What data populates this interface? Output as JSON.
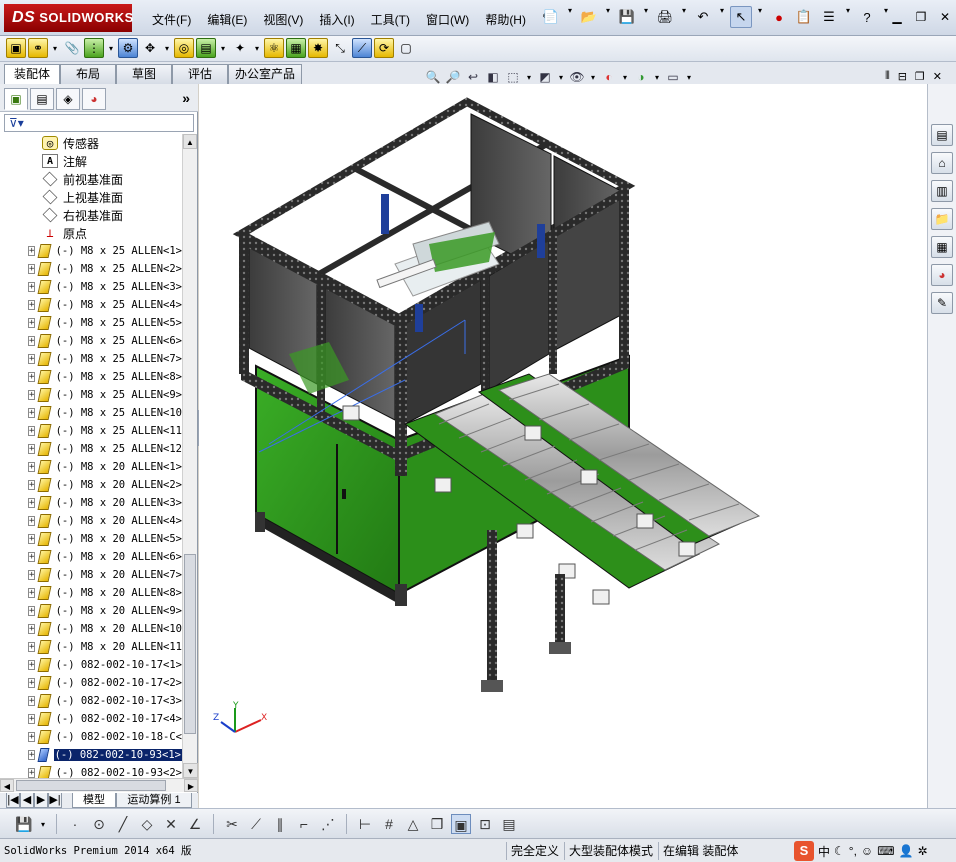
{
  "app": {
    "logo_ds": "DS",
    "logo_text": "SOLIDWORKS"
  },
  "menus": [
    "文件(F)",
    "编辑(E)",
    "视图(V)",
    "插入(I)",
    "工具(T)",
    "窗口(W)",
    "帮助(H)"
  ],
  "command_tabs": [
    "装配体",
    "布局",
    "草图",
    "评估",
    "办公室产品"
  ],
  "feature_tree": {
    "items": [
      {
        "label": "传感器",
        "icon": "sensor-icon",
        "expandable": false,
        "cn": true
      },
      {
        "label": "注解",
        "icon": "annotation-icon",
        "expandable": false,
        "cn": true
      },
      {
        "label": "前视基准面",
        "icon": "plane-icon",
        "expandable": false,
        "cn": true
      },
      {
        "label": "上视基准面",
        "icon": "plane-icon",
        "expandable": false,
        "cn": true
      },
      {
        "label": "右视基准面",
        "icon": "plane-icon",
        "expandable": false,
        "cn": true
      },
      {
        "label": "原点",
        "icon": "origin-icon",
        "expandable": false,
        "cn": true
      },
      {
        "label": "(-) M8 x 25 ALLEN<1>",
        "icon": "part-icon",
        "expandable": true
      },
      {
        "label": "(-) M8 x 25 ALLEN<2>",
        "icon": "part-icon",
        "expandable": true
      },
      {
        "label": "(-) M8 x 25 ALLEN<3>",
        "icon": "part-icon",
        "expandable": true
      },
      {
        "label": "(-) M8 x 25 ALLEN<4>",
        "icon": "part-icon",
        "expandable": true
      },
      {
        "label": "(-) M8 x 25 ALLEN<5>",
        "icon": "part-icon",
        "expandable": true
      },
      {
        "label": "(-) M8 x 25 ALLEN<6>",
        "icon": "part-icon",
        "expandable": true
      },
      {
        "label": "(-) M8 x 25 ALLEN<7>",
        "icon": "part-icon",
        "expandable": true
      },
      {
        "label": "(-) M8 x 25 ALLEN<8>",
        "icon": "part-icon",
        "expandable": true
      },
      {
        "label": "(-) M8 x 25 ALLEN<9>",
        "icon": "part-icon",
        "expandable": true
      },
      {
        "label": "(-) M8 x 25 ALLEN<10",
        "icon": "part-icon",
        "expandable": true
      },
      {
        "label": "(-) M8 x 25 ALLEN<11",
        "icon": "part-icon",
        "expandable": true
      },
      {
        "label": "(-) M8 x 25 ALLEN<12",
        "icon": "part-icon",
        "expandable": true
      },
      {
        "label": "(-) M8 x 20 ALLEN<1>",
        "icon": "part-icon",
        "expandable": true
      },
      {
        "label": "(-) M8 x 20 ALLEN<2>",
        "icon": "part-icon",
        "expandable": true
      },
      {
        "label": "(-) M8 x 20 ALLEN<3>",
        "icon": "part-icon",
        "expandable": true
      },
      {
        "label": "(-) M8 x 20 ALLEN<4>",
        "icon": "part-icon",
        "expandable": true
      },
      {
        "label": "(-) M8 x 20 ALLEN<5>",
        "icon": "part-icon",
        "expandable": true
      },
      {
        "label": "(-) M8 x 20 ALLEN<6>",
        "icon": "part-icon",
        "expandable": true
      },
      {
        "label": "(-) M8 x 20 ALLEN<7>",
        "icon": "part-icon",
        "expandable": true
      },
      {
        "label": "(-) M8 x 20 ALLEN<8>",
        "icon": "part-icon",
        "expandable": true
      },
      {
        "label": "(-) M8 x 20 ALLEN<9>",
        "icon": "part-icon",
        "expandable": true
      },
      {
        "label": "(-) M8 x 20 ALLEN<10",
        "icon": "part-icon",
        "expandable": true
      },
      {
        "label": "(-) M8 x 20 ALLEN<11",
        "icon": "part-icon",
        "expandable": true
      },
      {
        "label": "(-) 082-002-10-17<1>",
        "icon": "part-icon",
        "expandable": true
      },
      {
        "label": "(-) 082-002-10-17<2>",
        "icon": "part-icon",
        "expandable": true
      },
      {
        "label": "(-) 082-002-10-17<3>",
        "icon": "part-icon",
        "expandable": true
      },
      {
        "label": "(-) 082-002-10-17<4>",
        "icon": "part-icon",
        "expandable": true
      },
      {
        "label": "(-) 082-002-10-18-C<",
        "icon": "part-icon",
        "expandable": true
      },
      {
        "label": "(-) 082-002-10-93<1>",
        "icon": "part-icon",
        "expandable": true,
        "selected": true
      },
      {
        "label": "(-) 082-002-10-93<2>",
        "icon": "part-icon",
        "expandable": true
      }
    ]
  },
  "bottom_tabs": [
    "模型",
    "运动算例 1"
  ],
  "status": {
    "product": "SolidWorks Premium 2014 x64 版",
    "cells": [
      "完全定义",
      "大型装配体模式",
      "在编辑 装配体"
    ]
  },
  "tray": {
    "ime": "S",
    "ime_lang": "中"
  },
  "triad": {
    "x": "X",
    "y": "Y",
    "z": "Z"
  },
  "colors": {
    "frame_green": "#2f9a1c",
    "frame_dark": "#1a1a1a",
    "selection": "#0a246a",
    "logo_red": "#c91a1a"
  }
}
